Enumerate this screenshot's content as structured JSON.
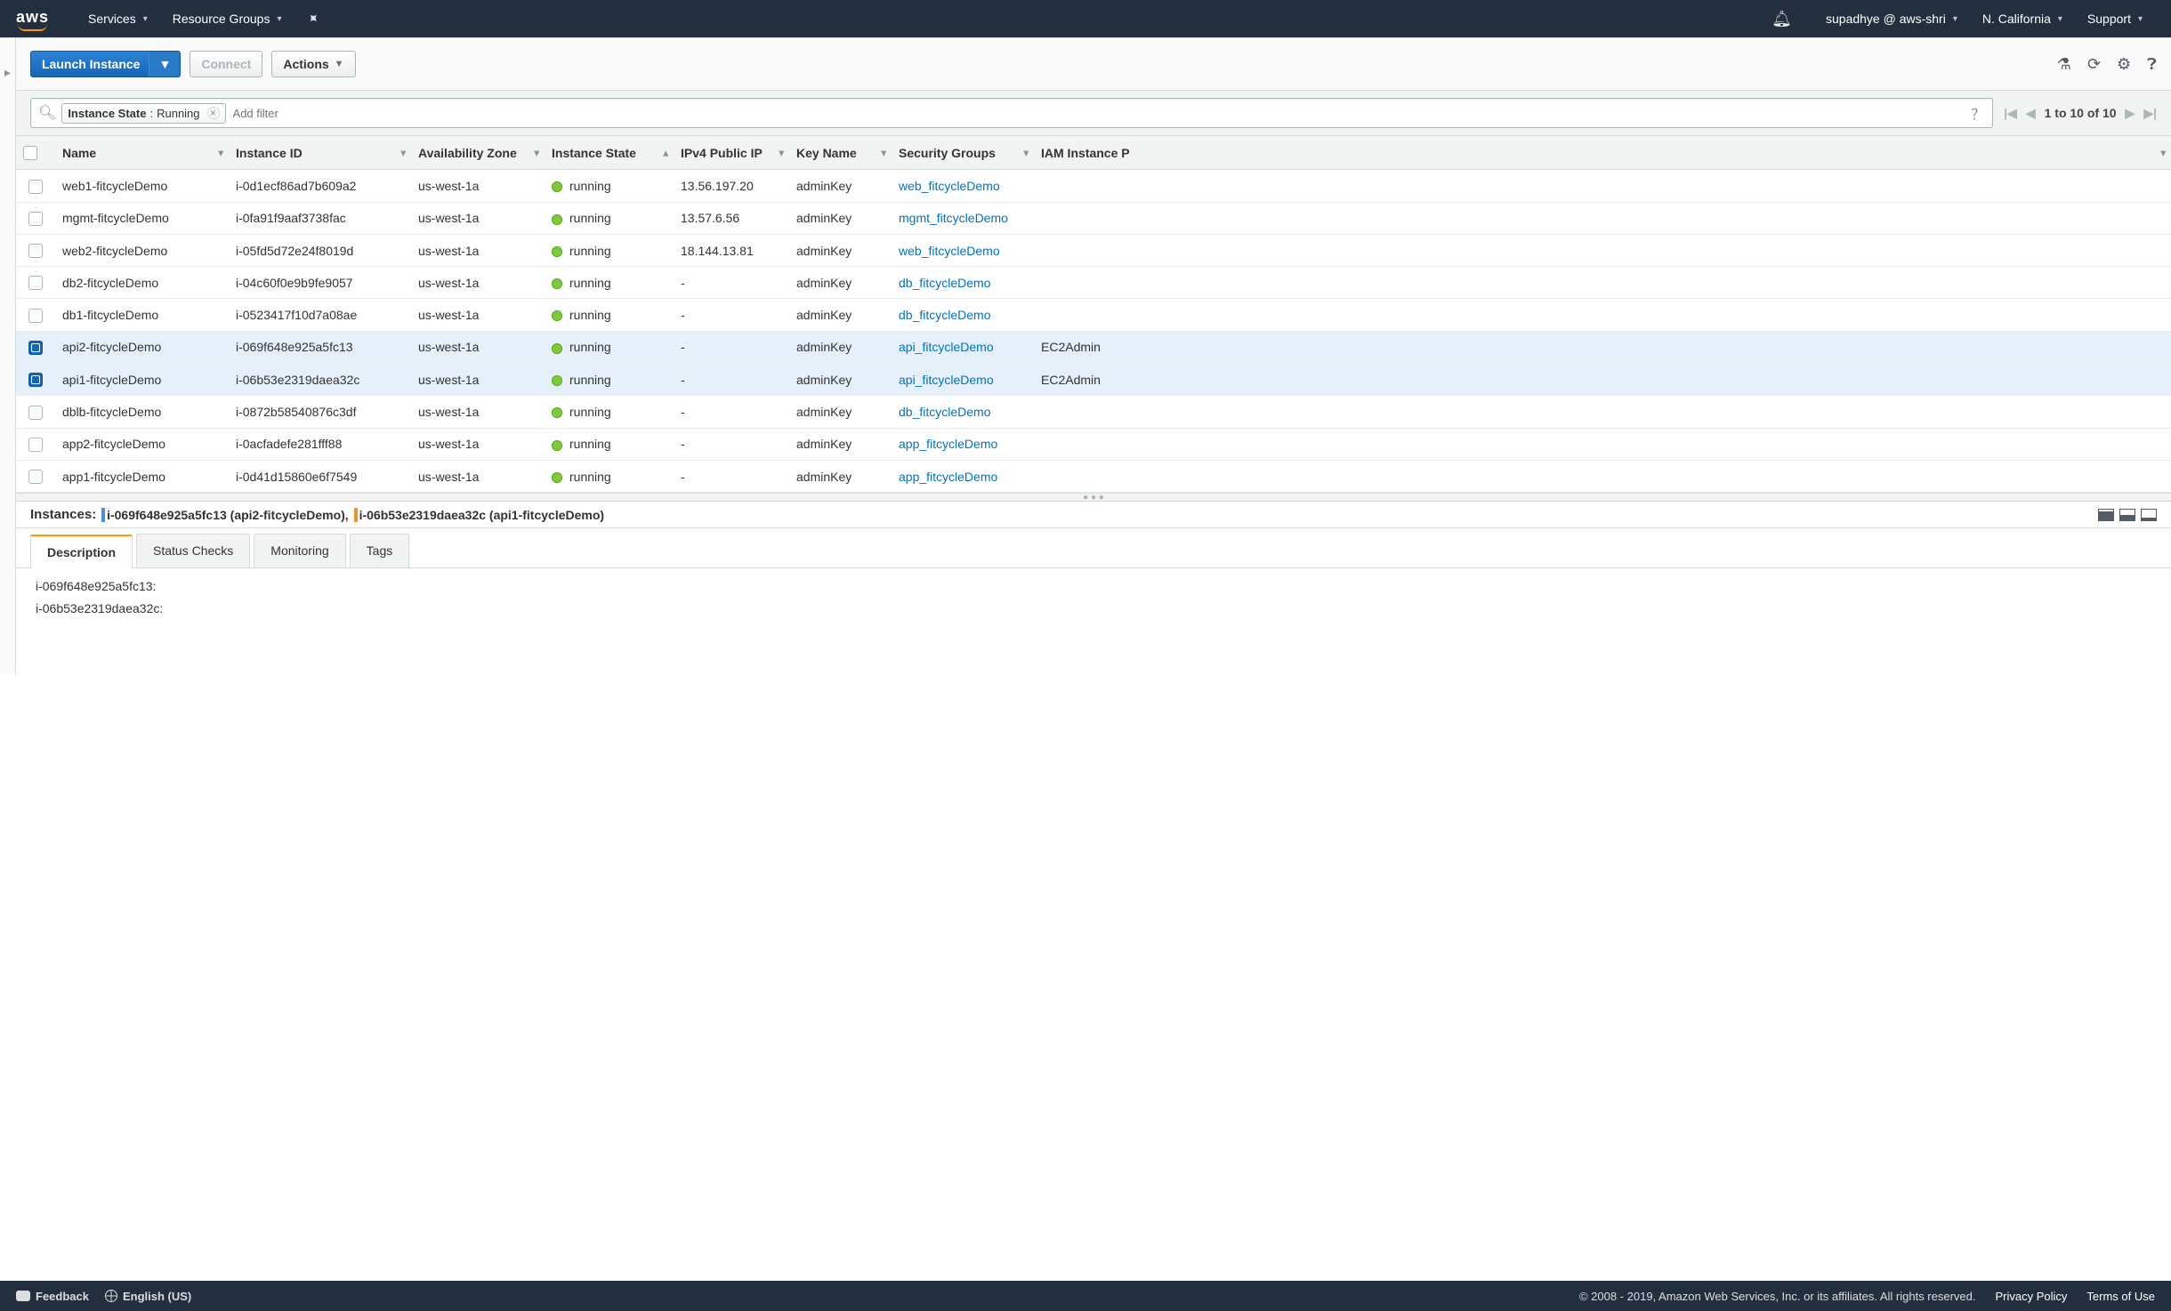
{
  "nav": {
    "logo": "aws",
    "services": "Services",
    "resource_groups": "Resource Groups",
    "user": "supadhye @ aws-shri",
    "region": "N. California",
    "support": "Support"
  },
  "toolbar": {
    "launch": "Launch Instance",
    "connect": "Connect",
    "actions": "Actions"
  },
  "filter": {
    "chip_key": "Instance State",
    "chip_value": "Running",
    "placeholder": "Add filter"
  },
  "pager": {
    "text": "1 to 10 of 10"
  },
  "columns": {
    "name": "Name",
    "instance_id": "Instance ID",
    "az": "Availability Zone",
    "state": "Instance State",
    "ip": "IPv4 Public IP",
    "key": "Key Name",
    "sg": "Security Groups",
    "iam": "IAM Instance P"
  },
  "rows": [
    {
      "sel": false,
      "name": "web1-fitcycleDemo",
      "id": "i-0d1ecf86ad7b609a2",
      "az": "us-west-1a",
      "state": "running",
      "ip": "13.56.197.20",
      "key": "adminKey",
      "sg": "web_fitcycleDemo",
      "iam": ""
    },
    {
      "sel": false,
      "name": "mgmt-fitcycleDemo",
      "id": "i-0fa91f9aaf3738fac",
      "az": "us-west-1a",
      "state": "running",
      "ip": "13.57.6.56",
      "key": "adminKey",
      "sg": "mgmt_fitcycleDemo",
      "iam": ""
    },
    {
      "sel": false,
      "name": "web2-fitcycleDemo",
      "id": "i-05fd5d72e24f8019d",
      "az": "us-west-1a",
      "state": "running",
      "ip": "18.144.13.81",
      "key": "adminKey",
      "sg": "web_fitcycleDemo",
      "iam": ""
    },
    {
      "sel": false,
      "name": "db2-fitcycleDemo",
      "id": "i-04c60f0e9b9fe9057",
      "az": "us-west-1a",
      "state": "running",
      "ip": "-",
      "key": "adminKey",
      "sg": "db_fitcycleDemo",
      "iam": ""
    },
    {
      "sel": false,
      "name": "db1-fitcycleDemo",
      "id": "i-0523417f10d7a08ae",
      "az": "us-west-1a",
      "state": "running",
      "ip": "-",
      "key": "adminKey",
      "sg": "db_fitcycleDemo",
      "iam": ""
    },
    {
      "sel": true,
      "name": "api2-fitcycleDemo",
      "id": "i-069f648e925a5fc13",
      "az": "us-west-1a",
      "state": "running",
      "ip": "-",
      "key": "adminKey",
      "sg": "api_fitcycleDemo",
      "iam": "EC2Admin"
    },
    {
      "sel": true,
      "name": "api1-fitcycleDemo",
      "id": "i-06b53e2319daea32c",
      "az": "us-west-1a",
      "state": "running",
      "ip": "-",
      "key": "adminKey",
      "sg": "api_fitcycleDemo",
      "iam": "EC2Admin"
    },
    {
      "sel": false,
      "name": "dblb-fitcycleDemo",
      "id": "i-0872b58540876c3df",
      "az": "us-west-1a",
      "state": "running",
      "ip": "-",
      "key": "adminKey",
      "sg": "db_fitcycleDemo",
      "iam": ""
    },
    {
      "sel": false,
      "name": "app2-fitcycleDemo",
      "id": "i-0acfadefe281fff88",
      "az": "us-west-1a",
      "state": "running",
      "ip": "-",
      "key": "adminKey",
      "sg": "app_fitcycleDemo",
      "iam": ""
    },
    {
      "sel": false,
      "name": "app1-fitcycleDemo",
      "id": "i-0d41d15860e6f7549",
      "az": "us-west-1a",
      "state": "running",
      "ip": "-",
      "key": "adminKey",
      "sg": "app_fitcycleDemo",
      "iam": ""
    }
  ],
  "detail": {
    "label": "Instances:",
    "inst1": "i-069f648e925a5fc13 (api2-fitcycleDemo),",
    "inst2": "i-06b53e2319daea32c (api1-fitcycleDemo)",
    "tabs": {
      "desc": "Description",
      "status": "Status Checks",
      "mon": "Monitoring",
      "tags": "Tags"
    },
    "line1": "i-069f648e925a5fc13:",
    "line2": "i-06b53e2319daea32c:"
  },
  "footer": {
    "feedback": "Feedback",
    "lang": "English (US)",
    "copyright": "© 2008 - 2019, Amazon Web Services, Inc. or its affiliates. All rights reserved.",
    "privacy": "Privacy Policy",
    "terms": "Terms of Use"
  }
}
